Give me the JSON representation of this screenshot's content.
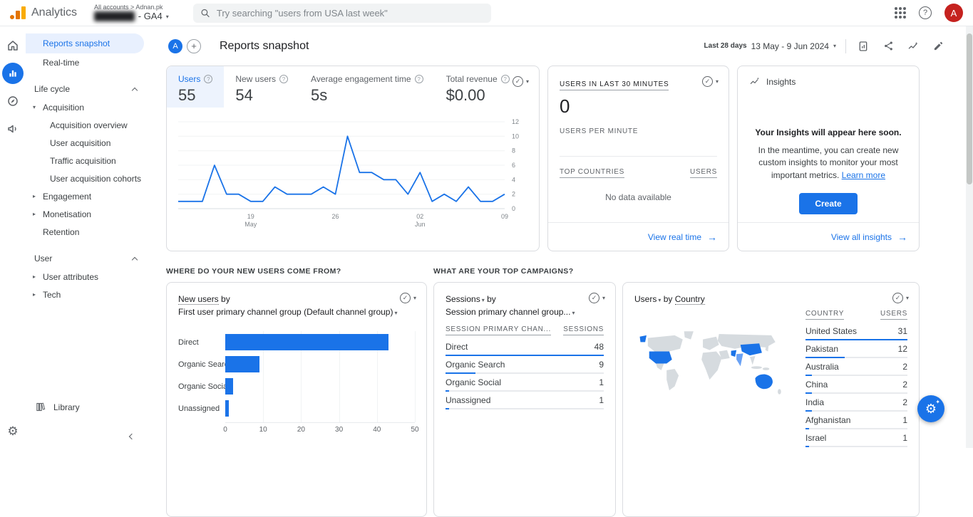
{
  "colors": {
    "accent": "#1a73e8",
    "accent_light": "#e8f0fe",
    "text": "#202124",
    "text_secondary": "#5f6368",
    "border": "#dadce0",
    "border_light": "#e8eaed",
    "search_bg": "#f1f3f4",
    "avatar_red": "#c5221f",
    "logo_orange": "#f9ab00",
    "logo_amber": "#e37400",
    "map_land": "#d6dbdf",
    "map_highlight": "#1a73e8",
    "map_highlight_soft": "#69a1f4"
  },
  "icons": {
    "caret_down": "▾",
    "triangle_down": "▾",
    "triangle_right": "▸",
    "arrow_right": "→",
    "check": "✓",
    "plus": "+",
    "question": "?",
    "gear": "⚙",
    "sparkle": "✦"
  },
  "topbar": {
    "app_name": "Analytics",
    "breadcrumb": "All accounts > Adnan.pk",
    "account_name": "Adnan.pk",
    "property_label": "- GA4",
    "search_placeholder": "Try searching \"users from USA last week\"",
    "avatar_letter": "A"
  },
  "sidebar": {
    "items": [
      {
        "label": "Reports snapshot",
        "type": "item",
        "active": true
      },
      {
        "label": "Real-time",
        "type": "item"
      },
      {
        "label": "Life cycle",
        "type": "section"
      },
      {
        "label": "Acquisition",
        "type": "parent",
        "state": "expanded"
      },
      {
        "label": "Acquisition overview",
        "type": "child"
      },
      {
        "label": "User acquisition",
        "type": "child"
      },
      {
        "label": "Traffic acquisition",
        "type": "child"
      },
      {
        "label": "User acquisition cohorts",
        "type": "child"
      },
      {
        "label": "Engagement",
        "type": "parent",
        "state": "collapsed"
      },
      {
        "label": "Monetisation",
        "type": "parent",
        "state": "collapsed"
      },
      {
        "label": "Retention",
        "type": "item"
      },
      {
        "label": "User",
        "type": "section"
      },
      {
        "label": "User attributes",
        "type": "parent",
        "state": "collapsed"
      },
      {
        "label": "Tech",
        "type": "parent",
        "state": "collapsed"
      }
    ],
    "library_label": "Library"
  },
  "main": {
    "avatar_letter": "A",
    "title": "Reports snapshot",
    "date_label": "Last 28 days",
    "date_range": "13 May - 9 Jun 2024"
  },
  "metric_card": {
    "tabs": [
      {
        "label": "Users",
        "value": "55",
        "selected": true
      },
      {
        "label": "New users",
        "value": "54",
        "selected": false
      },
      {
        "label": "Average engagement time",
        "value": "5s",
        "selected": false
      },
      {
        "label": "Total revenue",
        "value": "$0.00",
        "selected": false
      }
    ]
  },
  "realtime_card": {
    "title": "USERS IN LAST 30 MINUTES",
    "value": "0",
    "per_minute_label": "USERS PER MINUTE",
    "col_country": "TOP COUNTRIES",
    "col_users": "USERS",
    "empty_text": "No data available",
    "footer_link": "View real time"
  },
  "insights_card": {
    "title": "Insights",
    "headline": "Your Insights will appear here soon.",
    "body": "In the meantime, you can create new custom insights to monitor your most important metrics.",
    "link": "Learn more",
    "button": "Create",
    "footer_link": "View all insights"
  },
  "section_questions": {
    "left": "WHERE DO YOUR NEW USERS COME FROM?",
    "right": "WHAT ARE YOUR TOP CAMPAIGNS?"
  },
  "new_users_card": {
    "metric": "New users",
    "by": "by",
    "dimension": "First user primary channel group (Default channel group)"
  },
  "sessions_card": {
    "metric": "Sessions",
    "by": "by",
    "dimension": "Session primary channel group...",
    "col_dim": "SESSION PRIMARY CHAN...",
    "col_val": "SESSIONS"
  },
  "countries_card": {
    "metric": "Users",
    "by": "by",
    "dimension": "Country",
    "col_dim": "COUNTRY",
    "col_val": "USERS"
  },
  "chart_data": [
    {
      "id": "users_over_time",
      "type": "line",
      "title": "Users (last 28 days)",
      "x": [
        "13 May",
        "14 May",
        "15 May",
        "16 May",
        "17 May",
        "18 May",
        "19 May",
        "20 May",
        "21 May",
        "22 May",
        "23 May",
        "24 May",
        "25 May",
        "26 May",
        "27 May",
        "28 May",
        "29 May",
        "30 May",
        "31 May",
        "1 Jun",
        "2 Jun",
        "3 Jun",
        "4 Jun",
        "5 Jun",
        "6 Jun",
        "7 Jun",
        "8 Jun",
        "9 Jun"
      ],
      "values": [
        1,
        1,
        1,
        6,
        2,
        2,
        1,
        1,
        3,
        2,
        2,
        2,
        3,
        2,
        10,
        5,
        5,
        4,
        4,
        2,
        5,
        1,
        2,
        1,
        3,
        1,
        1,
        2
      ],
      "ylim": [
        0,
        12
      ],
      "yticks": [
        0,
        2,
        4,
        6,
        8,
        10,
        12
      ],
      "xticks": [
        {
          "label": "19",
          "sub": "May",
          "index": 6
        },
        {
          "label": "26",
          "index": 13
        },
        {
          "label": "02",
          "sub": "Jun",
          "index": 20
        },
        {
          "label": "09",
          "index": 27
        }
      ],
      "series_color": "#1a73e8",
      "grid": true,
      "legend": "none"
    },
    {
      "id": "new_users_by_channel",
      "type": "bar",
      "orientation": "horizontal",
      "title": "New users by First user primary channel group (Default channel group)",
      "categories": [
        "Direct",
        "Organic Search",
        "Organic Social",
        "Unassigned"
      ],
      "values": [
        43,
        9,
        2,
        1
      ],
      "xlim": [
        0,
        50
      ],
      "xticks": [
        0,
        10,
        20,
        30,
        40,
        50
      ],
      "bar_color": "#1a73e8"
    },
    {
      "id": "sessions_by_channel",
      "type": "table",
      "title": "Sessions by Session primary channel group",
      "columns": [
        "SESSION PRIMARY CHAN...",
        "SESSIONS"
      ],
      "rows": [
        [
          "Direct",
          48
        ],
        [
          "Organic Search",
          9
        ],
        [
          "Organic Social",
          1
        ],
        [
          "Unassigned",
          1
        ]
      ]
    },
    {
      "id": "users_by_country",
      "type": "table",
      "title": "Users by Country",
      "columns": [
        "COUNTRY",
        "USERS"
      ],
      "rows": [
        [
          "United States",
          31
        ],
        [
          "Pakistan",
          12
        ],
        [
          "Australia",
          2
        ],
        [
          "China",
          2
        ],
        [
          "India",
          2
        ],
        [
          "Afghanistan",
          1
        ],
        [
          "Israel",
          1
        ]
      ],
      "map_highlighted": [
        "United States",
        "Pakistan",
        "India",
        "China",
        "Australia"
      ]
    }
  ]
}
